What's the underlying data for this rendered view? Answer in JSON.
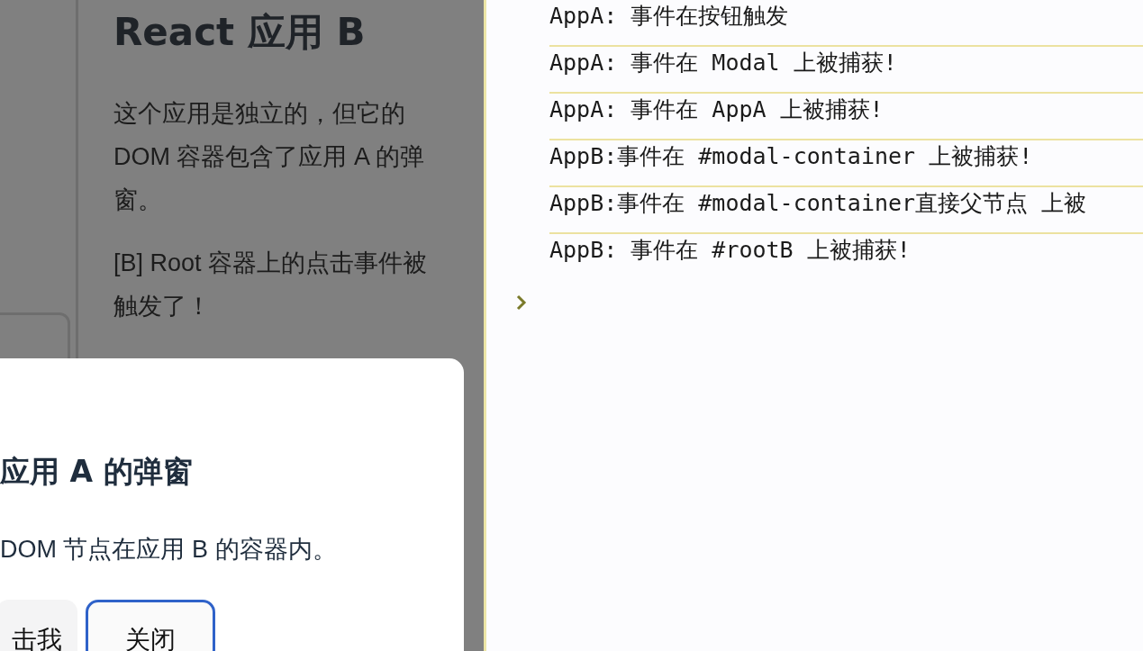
{
  "app_b": {
    "title": "React 应用 B",
    "paragraphs": [
      "这个应用是独立的，但它的 DOM 容器包含了应用 A 的弹窗。",
      "[B] Root 容器上的点击事件被触发了！"
    ]
  },
  "modal": {
    "title": "应用 A 的弹窗",
    "text": "DOM 节点在应用 B 的容器内。",
    "buttons": [
      {
        "label": "击我",
        "kind": "secondary"
      },
      {
        "label": "关闭",
        "kind": "focused"
      }
    ]
  },
  "console": {
    "lines": [
      "AppA: 事件在按钮触发",
      "AppA: 事件在 Modal 上被捕获!",
      "AppA: 事件在 AppA 上被捕获!",
      "AppB:事件在 #modal-container 上被捕获!",
      "AppB:事件在 #modal-container直接父节点 上被",
      "AppB: 事件在 #rootB 上被捕获!"
    ]
  }
}
